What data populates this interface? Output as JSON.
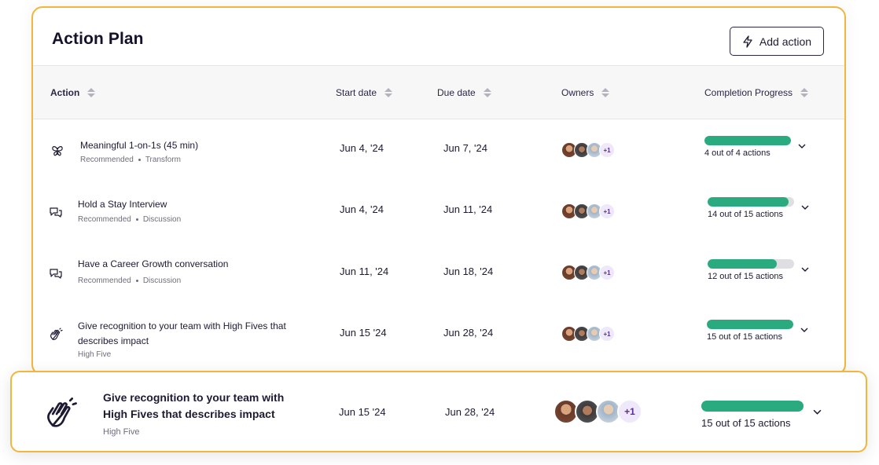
{
  "header": {
    "title": "Action Plan",
    "add_button_label": "Add action"
  },
  "columns": {
    "action": "Action",
    "start_date": "Start date",
    "due_date": "Due date",
    "owners": "Owners",
    "completion": "Completion Progress"
  },
  "rows": [
    {
      "icon": "butterfly-icon",
      "title": "Meaningful 1-on-1s (45 min)",
      "tag1": "Recommended",
      "tag2": "Transform",
      "start": "Jun 4, '24",
      "due": "Jun 7, '24",
      "owners_extra": "+1",
      "progress_fraction": 1.0,
      "progress_text": "4 out of 4 actions"
    },
    {
      "icon": "chat-bubbles-icon",
      "title": "Hold a Stay Interview",
      "tag1": "Recommended",
      "tag2": "Discussion",
      "start": "Jun 4, '24",
      "due": "Jun 11, '24",
      "owners_extra": "+1",
      "progress_fraction": 0.933,
      "progress_text": "14 out of 15 actions"
    },
    {
      "icon": "chat-bubbles-icon",
      "title": "Have a Career Growth conversation",
      "tag1": "Recommended",
      "tag2": "Discussion",
      "start": "Jun 11, '24",
      "due": "Jun 18, '24",
      "owners_extra": "+1",
      "progress_fraction": 0.8,
      "progress_text": "12 out of 15 actions"
    },
    {
      "icon": "high-five-hand-icon",
      "title_line1": "Give recognition to your team with High Fives that",
      "title_line2": "describes impact",
      "tag1": "High Five",
      "start": "Jun 15 '24",
      "due": "Jun 28, '24",
      "owners_extra": "+1",
      "progress_fraction": 1.0,
      "progress_text": "15 out of 15 actions"
    }
  ],
  "featured": {
    "icon": "high-five-hand-icon",
    "title_line1": "Give recognition to your team with",
    "title_line2": "High Fives that describes impact",
    "tag1": "High Five",
    "start": "Jun 15 '24",
    "due": "Jun 28, '24",
    "owners_extra": "+1",
    "progress_fraction": 1.0,
    "progress_text": "15 out of 15 actions"
  },
  "colors": {
    "accent_border": "#f2b63c",
    "progress_fill": "#2aaa7f",
    "progress_track": "#dedee3",
    "plus_badge_bg": "#efe7fa"
  }
}
